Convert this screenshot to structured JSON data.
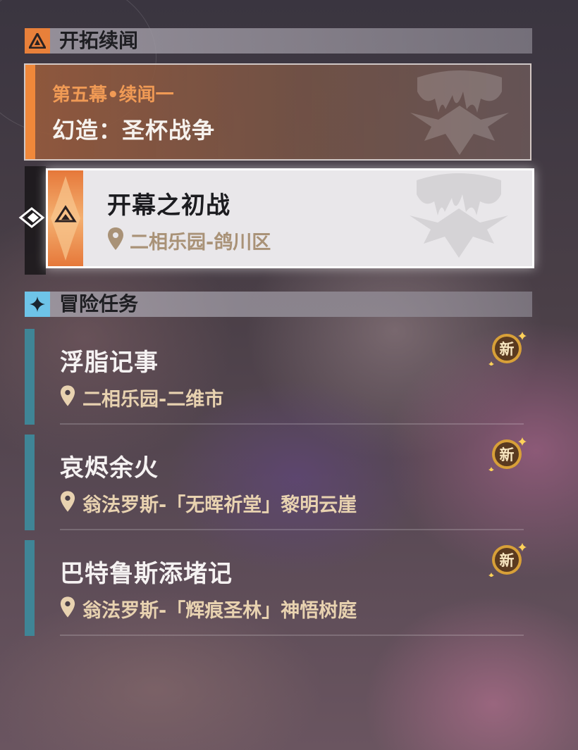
{
  "trailblaze_section": {
    "title": "开拓续闻",
    "icon": "trailblaze-mission-icon"
  },
  "chapter": {
    "subtitle": "第五幕•续闻一",
    "title": "幻造：圣杯战争",
    "emblem": "grail-emblem"
  },
  "current_quest": {
    "name": "开幕之初战",
    "location": "二相乐园-鸽川区",
    "icon": "trailblaze-diamond-icon"
  },
  "adventure_section": {
    "title": "冒险任务",
    "icon": "adventure-star-icon"
  },
  "adventure_missions": [
    {
      "name": "浮脂记事",
      "location": "二相乐园-二维市",
      "badge": "新"
    },
    {
      "name": "哀烬余火",
      "location": "翁法罗斯-「无晖祈堂」黎明云崖",
      "badge": "新"
    },
    {
      "name": "巴特鲁斯添堵记",
      "location": "翁法罗斯-「辉痕圣林」神悟树庭",
      "badge": "新"
    }
  ],
  "colors": {
    "trailblaze_accent": "#f0883a",
    "adventure_accent": "#6ec4e8",
    "adventure_bar": "#3f8596",
    "location_text": "#e8d2b0"
  }
}
